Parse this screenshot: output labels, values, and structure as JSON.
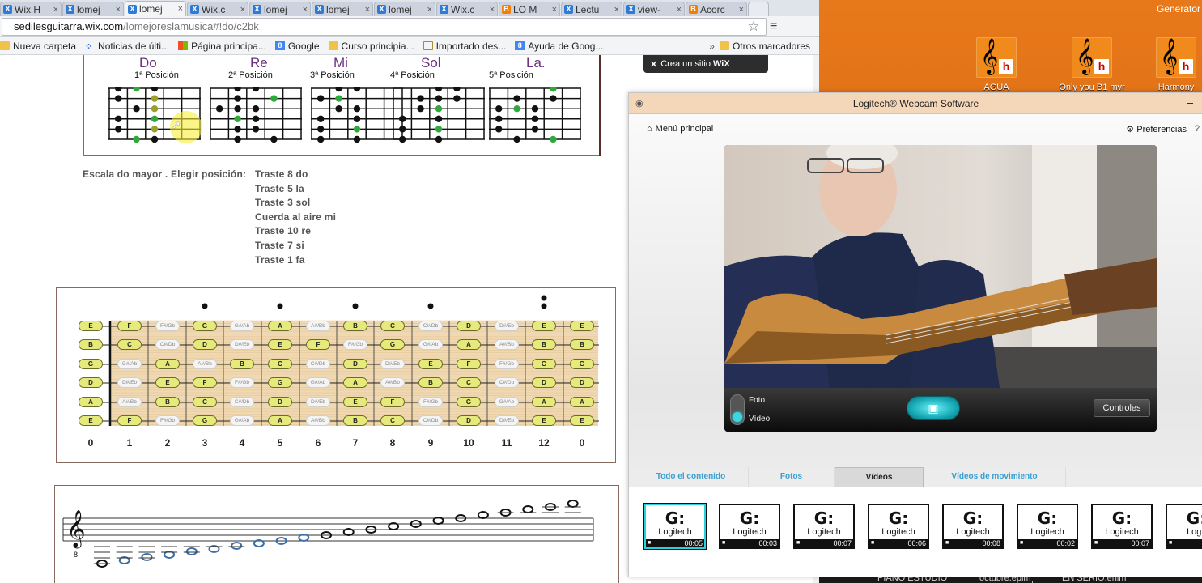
{
  "browser": {
    "tabs": [
      {
        "label": "Wix H",
        "icon": "wix-favicon",
        "active": false
      },
      {
        "label": "lomej",
        "icon": "wix-favicon",
        "active": false
      },
      {
        "label": "lomej",
        "icon": "wix-favicon",
        "active": true
      },
      {
        "label": "Wix.c",
        "icon": "wix-favicon",
        "active": false
      },
      {
        "label": "lomej",
        "icon": "wix-favicon",
        "active": false
      },
      {
        "label": "lomej",
        "icon": "wix-favicon",
        "active": false
      },
      {
        "label": "lomej",
        "icon": "wix-favicon",
        "active": false
      },
      {
        "label": "Wix.c",
        "icon": "wix-favicon",
        "active": false
      },
      {
        "label": "LO M",
        "icon": "blogger-favicon",
        "active": false
      },
      {
        "label": "Lectu",
        "icon": "wix-favicon",
        "active": false
      },
      {
        "label": "view-",
        "icon": "wix-favicon",
        "active": false
      },
      {
        "label": "Acorc",
        "icon": "blogger-favicon",
        "active": false
      }
    ],
    "url_domain": "sedilesguitarra.wix.com",
    "url_path": "/lomejoreslamusica#!do/c2bk",
    "bookmarks": [
      {
        "label": "Nueva carpeta",
        "icon": "folder"
      },
      {
        "label": "Noticias de últi...",
        "icon": "dots"
      },
      {
        "label": "Página principa...",
        "icon": "ms"
      },
      {
        "label": "Google",
        "icon": "g"
      },
      {
        "label": "Curso principia...",
        "icon": "folder"
      },
      {
        "label": "Importado des...",
        "icon": "folder-outline"
      },
      {
        "label": "Ayuda de Goog...",
        "icon": "g"
      }
    ],
    "bookmarks_more": "»",
    "bookmarks_other": "Otros marcadores"
  },
  "page": {
    "top_figure": {
      "notes": [
        "Do",
        "Re",
        "Mi",
        "Sol",
        "La."
      ],
      "positions": [
        "1ª Posición",
        "2ª Posición",
        "3ª Posición",
        "4ª Posición",
        "5ª Posición"
      ]
    },
    "instructions": {
      "label": "Escala do mayor . Elegir posición:",
      "lines": [
        "Traste 8 do",
        "Traste 5  la",
        "Traste 3 sol",
        "Cuerda al aire   mi",
        "Traste 10  re",
        "Traste 7  si",
        "Traste 1  fa"
      ]
    },
    "fretboard": {
      "fret_numbers": [
        "0",
        "1",
        "2",
        "3",
        "4",
        "5",
        "6",
        "7",
        "8",
        "9",
        "10",
        "11",
        "12",
        "0"
      ],
      "strings": [
        [
          "E",
          "F",
          "F#/Gb",
          "G",
          "G#/Ab",
          "A",
          "A#/Bb",
          "B",
          "C",
          "C#/Db",
          "D",
          "D#/Eb",
          "E",
          "E"
        ],
        [
          "B",
          "C",
          "C#/Db",
          "D",
          "D#/Eb",
          "E",
          "F",
          "F#/Gb",
          "G",
          "G#/Ab",
          "A",
          "A#/Bb",
          "B",
          "B"
        ],
        [
          "G",
          "G#/Ab",
          "A",
          "A#/Bb",
          "B",
          "C",
          "C#/Db",
          "D",
          "D#/Eb",
          "E",
          "F",
          "F#/Gb",
          "G",
          "G"
        ],
        [
          "D",
          "D#/Eb",
          "E",
          "F",
          "F#/Gb",
          "G",
          "G#/Ab",
          "A",
          "A#/Bb",
          "B",
          "C",
          "C#/Db",
          "D",
          "D"
        ],
        [
          "A",
          "A#/Bb",
          "B",
          "C",
          "C#/Db",
          "D",
          "D#/Eb",
          "E",
          "F",
          "F#/Gb",
          "G",
          "G#/Ab",
          "A",
          "A"
        ],
        [
          "E",
          "F",
          "F#/Gb",
          "G",
          "G#/Ab",
          "A",
          "A#/Bb",
          "B",
          "C",
          "C#/Db",
          "D",
          "D#/Eb",
          "E",
          "E"
        ]
      ]
    },
    "wix_banner": {
      "prefix": "Crea un sitio",
      "brand": "WiX"
    }
  },
  "desktop": {
    "title": "Generator",
    "icons": [
      {
        "label": "AGUA"
      },
      {
        "label": "Only you B1 mvr"
      },
      {
        "label": "Harmony"
      }
    ],
    "taskbar": [
      "PIANO ESTUDIO",
      "octubre.epim",
      "EN SERIO.enim"
    ]
  },
  "webcam": {
    "title": "Logitech® Webcam Software",
    "home_label": "Menú principal",
    "prefs_label": "Preferencias",
    "foto_label": "Foto",
    "video_label": "Vídeo",
    "controls_label": "Controles",
    "tabs": [
      "Todo el contenido",
      "Fotos",
      "Vídeos",
      "Vídeos de movimiento"
    ],
    "active_tab": "Vídeos",
    "thumbs": [
      {
        "logo": "Logitech",
        "duration": "00:05",
        "selected": true
      },
      {
        "logo": "Logitech",
        "duration": "00:03",
        "selected": false
      },
      {
        "logo": "Logitech",
        "duration": "00:07",
        "selected": false
      },
      {
        "logo": "Logitech",
        "duration": "00:06",
        "selected": false
      },
      {
        "logo": "Logitech",
        "duration": "00:08",
        "selected": false
      },
      {
        "logo": "Logitech",
        "duration": "00:02",
        "selected": false
      },
      {
        "logo": "Logitech",
        "duration": "00:07",
        "selected": false
      },
      {
        "logo": "Logit",
        "duration": "",
        "selected": false
      }
    ]
  },
  "colors": {
    "note_purple": "#6d2f7f",
    "note_green": "#2faa3a",
    "accent_cyan": "#2ad0de",
    "desktop_orange": "#d66514"
  }
}
